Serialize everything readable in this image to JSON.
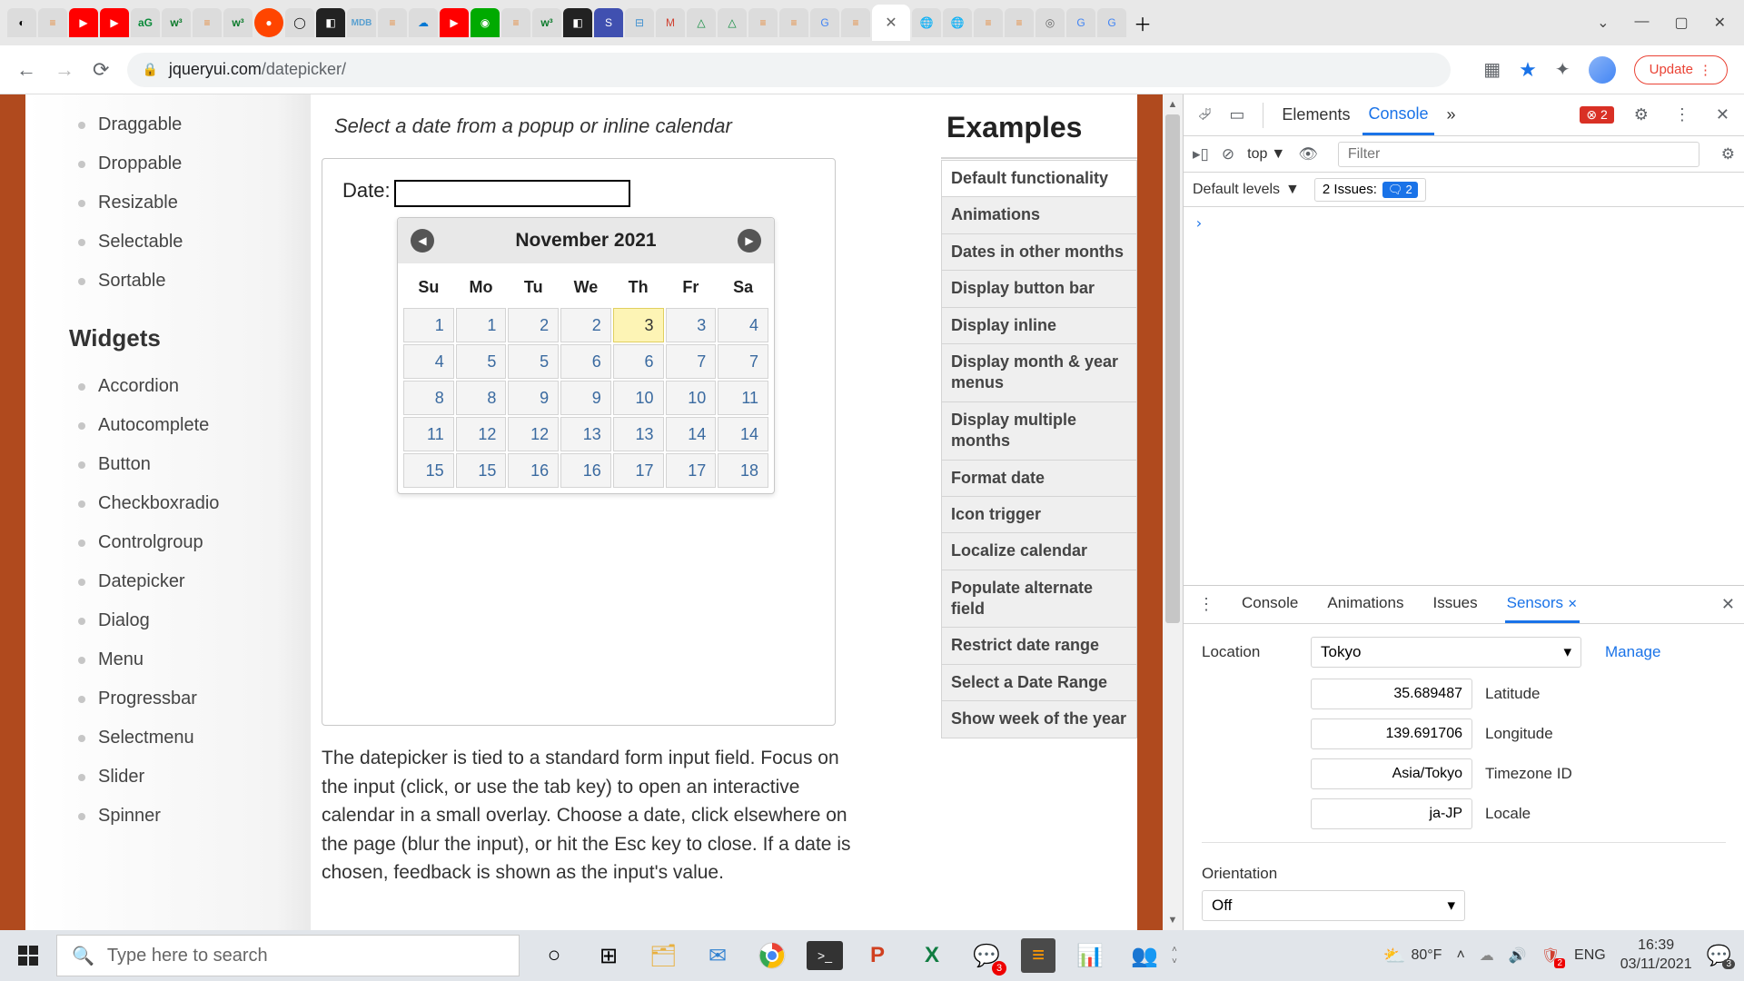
{
  "browser": {
    "url_host": "jqueryui.com",
    "url_path": "/datepicker/",
    "update_label": "Update",
    "active_tab_close": "✕",
    "new_tab": "＋"
  },
  "sidebar": {
    "items_top": [
      "Draggable",
      "Droppable",
      "Resizable",
      "Selectable",
      "Sortable"
    ],
    "header": "Widgets",
    "items_widgets": [
      "Accordion",
      "Autocomplete",
      "Button",
      "Checkboxradio",
      "Controlgroup",
      "Datepicker",
      "Dialog",
      "Menu",
      "Progressbar",
      "Selectmenu",
      "Slider",
      "Spinner"
    ]
  },
  "main": {
    "intro": "Select a date from a popup or inline calendar",
    "date_label": "Date:",
    "date_value": "",
    "cal_title": "November 2021",
    "day_headers": [
      "Su",
      "Mo",
      "Tu",
      "We",
      "Th",
      "Fr",
      "Sa"
    ],
    "weeks": [
      [
        "1",
        "1",
        "2",
        "2",
        "3",
        "3",
        "4"
      ],
      [
        "4",
        "5",
        "5",
        "6",
        "6",
        "7",
        "7"
      ],
      [
        "8",
        "8",
        "9",
        "9",
        "10",
        "10",
        "11"
      ],
      [
        "11",
        "12",
        "12",
        "13",
        "13",
        "14",
        "14"
      ],
      [
        "15",
        "15",
        "16",
        "16",
        "17",
        "17",
        "18"
      ]
    ],
    "today_row": 0,
    "today_col": 4,
    "description": "The datepicker is tied to a standard form input field. Focus on the input (click, or use the tab key) to open an interactive calendar in a small overlay. Choose a date, click elsewhere on the page (blur the input), or hit the Esc key to close. If a date is chosen, feedback is shown as the input's value."
  },
  "examples": {
    "heading": "Examples",
    "items": [
      "Default functionality",
      "Animations",
      "Dates in other months",
      "Display button bar",
      "Display inline",
      "Display month & year menus",
      "Display multiple months",
      "Format date",
      "Icon trigger",
      "Localize calendar",
      "Populate alternate field",
      "Restrict date range",
      "Select a Date Range",
      "Show week of the year"
    ],
    "active_index": 0
  },
  "devtools": {
    "tabs": {
      "elements": "Elements",
      "console": "Console",
      "more": "»"
    },
    "error_count": "2",
    "toolbar": {
      "context": "top",
      "filter_placeholder": "Filter"
    },
    "levels": "Default levels",
    "issues_label": "2 Issues:",
    "issues_badge": "2",
    "prompt": "›",
    "drawer": {
      "tabs": [
        "Console",
        "Animations",
        "Issues",
        "Sensors"
      ],
      "active_tab": "Sensors",
      "close_icon": "✕",
      "location_label": "Location",
      "location_value": "Tokyo",
      "manage": "Manage",
      "lat": "35.689487",
      "lat_label": "Latitude",
      "lon": "139.691706",
      "lon_label": "Longitude",
      "tz": "Asia/Tokyo",
      "tz_label": "Timezone ID",
      "locale": "ja-JP",
      "locale_label": "Locale",
      "orientation_label": "Orientation",
      "orientation_value": "Off"
    }
  },
  "taskbar": {
    "search_placeholder": "Type here to search",
    "weather": "80°F",
    "lang": "ENG",
    "time": "16:39",
    "date": "03/11/2021",
    "notif_count": "3",
    "skype_badge": "3",
    "sec_badge": "2"
  }
}
